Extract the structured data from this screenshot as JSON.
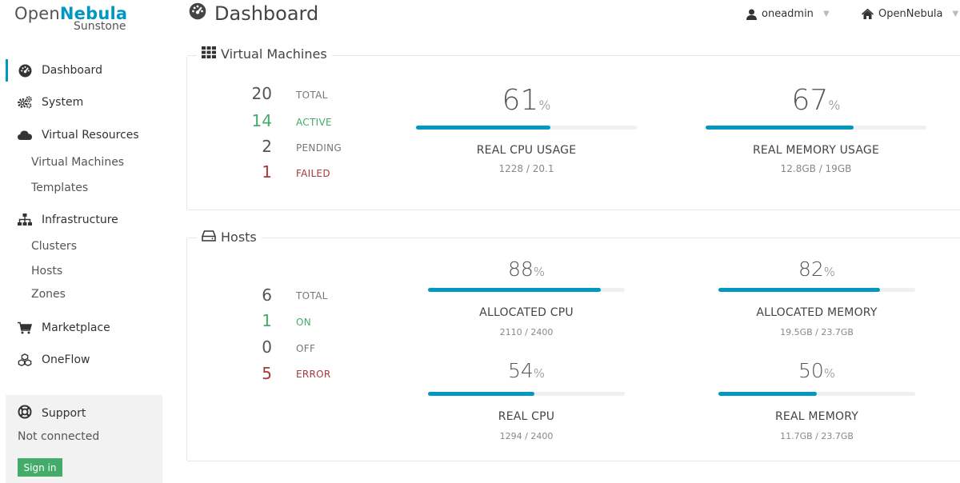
{
  "logo": {
    "brand_prefix": "Open",
    "brand_strong": "Nebula",
    "product": "Sunstone"
  },
  "sidebar": {
    "items": [
      {
        "label": "Dashboard",
        "icon": "dashboard-icon"
      },
      {
        "label": "System",
        "icon": "cogs-icon"
      },
      {
        "label": "Virtual Resources",
        "icon": "cloud-icon"
      },
      {
        "label": "Virtual Machines"
      },
      {
        "label": "Templates"
      },
      {
        "label": "Infrastructure",
        "icon": "sitemap-icon"
      },
      {
        "label": "Clusters"
      },
      {
        "label": "Hosts"
      },
      {
        "label": "Zones"
      },
      {
        "label": "Marketplace",
        "icon": "shopping-cart-icon"
      },
      {
        "label": "OneFlow",
        "icon": "cubes-icon"
      }
    ],
    "support": {
      "title": "Support",
      "status": "Not connected",
      "signin": "Sign in"
    }
  },
  "header": {
    "title": "Dashboard",
    "user": "oneadmin",
    "zone": "OpenNebula"
  },
  "vms": {
    "title": "Virtual Machines",
    "counts": [
      {
        "value": "20",
        "label": "TOTAL"
      },
      {
        "value": "14",
        "label": "ACTIVE"
      },
      {
        "value": "2",
        "label": "PENDING"
      },
      {
        "value": "1",
        "label": "FAILED"
      }
    ],
    "gauges": [
      {
        "value": "61",
        "unit": "%",
        "fraction": 0.61,
        "label": "REAL CPU USAGE",
        "sub": "1228 / 20.1"
      },
      {
        "value": "67",
        "unit": "%",
        "fraction": 0.67,
        "label": "REAL MEMORY USAGE",
        "sub": "12.8GB / 19GB"
      }
    ]
  },
  "hosts": {
    "title": "Hosts",
    "counts": [
      {
        "value": "6",
        "label": "TOTAL"
      },
      {
        "value": "1",
        "label": "ON"
      },
      {
        "value": "0",
        "label": "OFF"
      },
      {
        "value": "5",
        "label": "ERROR"
      }
    ],
    "gauges": [
      {
        "value": "88",
        "unit": "%",
        "fraction": 0.88,
        "label": "ALLOCATED CPU",
        "sub": "2110 / 2400"
      },
      {
        "value": "82",
        "unit": "%",
        "fraction": 0.82,
        "label": "ALLOCATED MEMORY",
        "sub": "19.5GB / 23.7GB"
      },
      {
        "value": "54",
        "unit": "%",
        "fraction": 0.54,
        "label": "REAL CPU",
        "sub": "1294 / 2400"
      },
      {
        "value": "50",
        "unit": "%",
        "fraction": 0.5,
        "label": "REAL MEMORY",
        "sub": "11.7GB / 23.7GB"
      }
    ]
  },
  "colors": {
    "accent": "#0098c3",
    "active": "#43ac6a",
    "error": "#a6393b",
    "signin": "#43ac6a"
  }
}
